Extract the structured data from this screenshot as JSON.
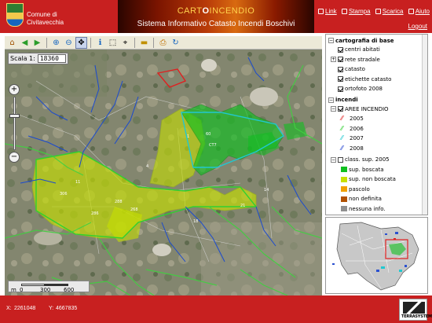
{
  "header": {
    "comune_line1": "Comune di",
    "comune_line2": "Civitavecchia",
    "brand_prefix": "CART",
    "brand_mid": "O",
    "brand_suffix": "INCENDIO",
    "title": "Sistema Informativo Catasto Incendi Boschivi",
    "links": [
      {
        "label": "Link",
        "icon": "link-icon"
      },
      {
        "label": "Stampa",
        "icon": "print-icon"
      },
      {
        "label": "Scarica",
        "icon": "download-icon"
      },
      {
        "label": "Aiuto",
        "icon": "help-icon"
      }
    ],
    "logout": "Logout"
  },
  "toolbar": {
    "tools": [
      "home-icon",
      "back-arrow-icon",
      "forward-arrow-icon",
      "zoom-in-icon",
      "zoom-out-icon",
      "pan-icon",
      "info-icon",
      "select-icon",
      "measure-icon",
      "ruler-icon",
      "print-map-icon",
      "refresh-icon"
    ]
  },
  "map": {
    "scale_label": "Scala 1:",
    "scale_value": "18360",
    "scalebar_labels": [
      "m",
      "0",
      "300",
      "600"
    ]
  },
  "status": {
    "x_label": "X:",
    "x_value": "2261048",
    "y_label": "Y:",
    "y_value": "4667835",
    "company": "TERRASYSTEM"
  },
  "layers": {
    "base_group": "cartografia di base",
    "base_items": [
      {
        "label": "centri abitati",
        "checked": true
      },
      {
        "label": "rete stradale",
        "checked": true,
        "expander": "+"
      },
      {
        "label": "catasto",
        "checked": true
      },
      {
        "label": "etichette catasto",
        "checked": true
      },
      {
        "label": "ortofoto 2008",
        "checked": true
      }
    ],
    "fire_group": "incendi",
    "aree_label": "AREE INCENDIO",
    "years": [
      {
        "label": "2005",
        "color": "#e02020"
      },
      {
        "label": "2006",
        "color": "#30d030"
      },
      {
        "label": "2007",
        "color": "#20c8d0"
      },
      {
        "label": "2008",
        "color": "#2040d0"
      }
    ],
    "class_label": "class. sup. 2005",
    "classes": [
      {
        "label": "sup. boscata",
        "color": "#10c020"
      },
      {
        "label": "sup. non boscata",
        "color": "#c8e000"
      },
      {
        "label": "pascolo",
        "color": "#f0a000"
      },
      {
        "label": "non definita",
        "color": "#b05000"
      },
      {
        "label": "nessuna info.",
        "color": "#909090"
      }
    ]
  }
}
